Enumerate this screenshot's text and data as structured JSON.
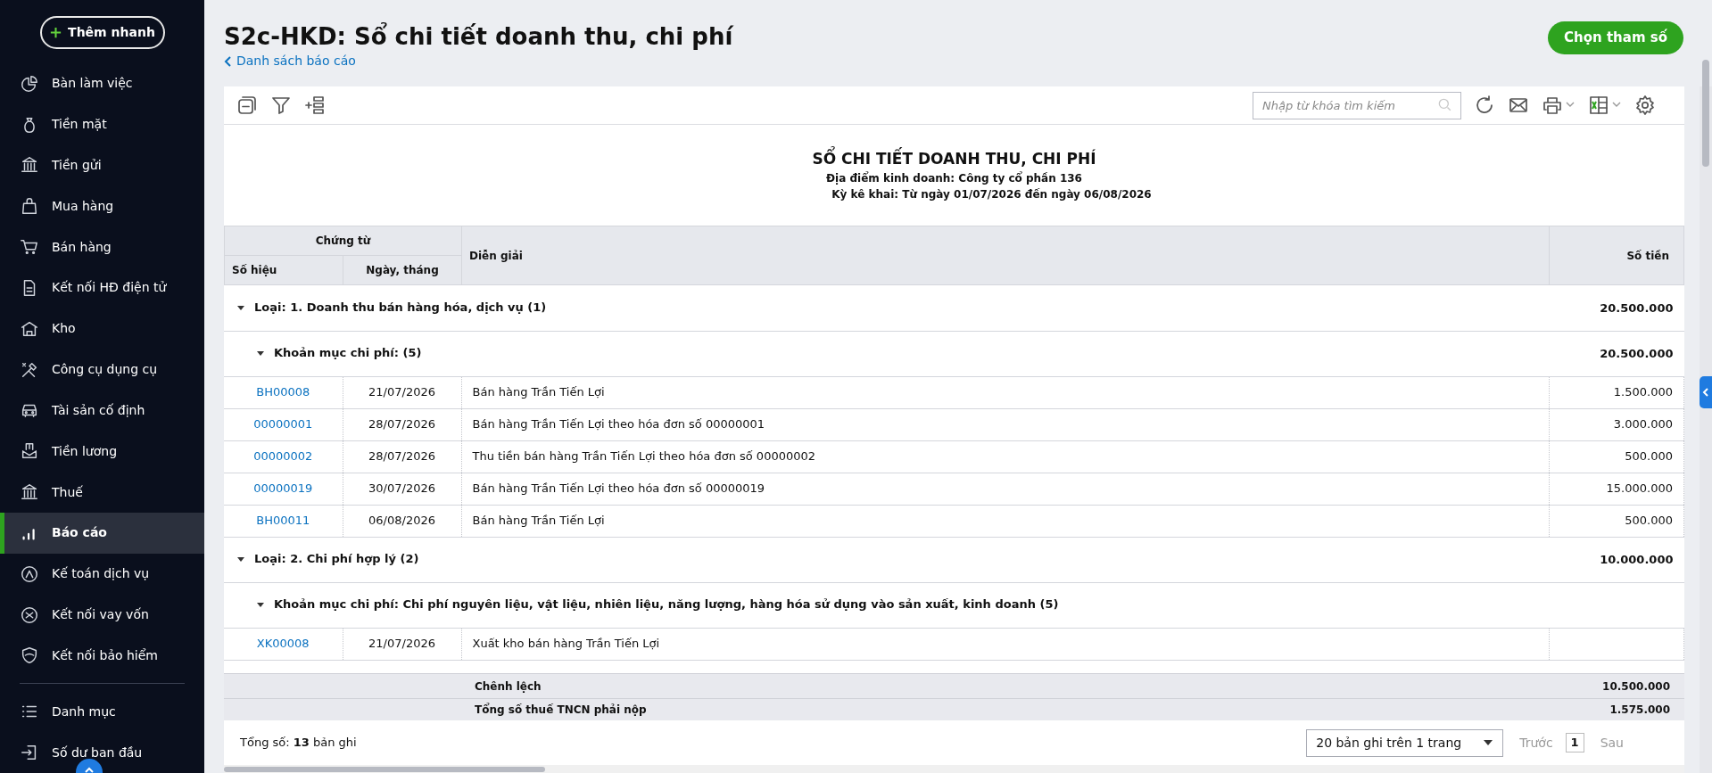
{
  "sidebar": {
    "quick_add": "Thêm nhanh",
    "items": [
      {
        "label": "Bàn làm việc",
        "selected": false
      },
      {
        "label": "Tiền mặt",
        "selected": false
      },
      {
        "label": "Tiền gửi",
        "selected": false
      },
      {
        "label": "Mua hàng",
        "selected": false
      },
      {
        "label": "Bán hàng",
        "selected": false
      },
      {
        "label": "Kết nối HĐ điện tử",
        "selected": false
      },
      {
        "label": "Kho",
        "selected": false
      },
      {
        "label": "Công cụ dụng cụ",
        "selected": false
      },
      {
        "label": "Tài sản cố định",
        "selected": false
      },
      {
        "label": "Tiền lương",
        "selected": false
      },
      {
        "label": "Thuế",
        "selected": false
      },
      {
        "label": "Báo cáo",
        "selected": true
      },
      {
        "label": "Kế toán dịch vụ",
        "selected": false
      },
      {
        "label": "Kết nối vay vốn",
        "selected": false
      },
      {
        "label": "Kết nối bảo hiểm",
        "selected": false
      }
    ],
    "footer_items": [
      {
        "label": "Danh mục",
        "selected": false
      },
      {
        "label": "Số dư ban đầu",
        "selected": false
      }
    ]
  },
  "page": {
    "title": "S2c-HKD: Sổ chi tiết doanh thu, chi phí",
    "back_link": "Danh sách báo cáo",
    "primary_button": "Chọn tham số"
  },
  "toolbar": {
    "search": {
      "placeholder": "Nhập từ khóa tìm kiếm"
    }
  },
  "report": {
    "title": "SỔ CHI TIẾT DOANH THU, CHI PHÍ",
    "lines": [
      "Địa điểm kinh doanh: Công ty cổ phần 136",
      "Kỳ kê khai: Từ ngày 01/07/2026 đến ngày 06/08/2026"
    ]
  },
  "table": {
    "header_group": "Chứng từ",
    "columns": [
      "Số hiệu",
      "Ngày, tháng",
      "Diễn giải",
      "Số tiền"
    ],
    "groups": [
      {
        "label": "Loại: 1. Doanh thu bán hàng hóa, dịch vụ (1)",
        "amount": "20.500.000",
        "expanded": true,
        "children": [
          {
            "label": "Khoản mục chi phí:  (5)",
            "amount": "20.500.000",
            "expanded": true,
            "rows": [
              {
                "number": "BH00008",
                "date": "21/07/2026",
                "description": "Bán hàng Trần Tiến Lợi",
                "amount": "1.500.000"
              },
              {
                "number": "00000001",
                "date": "28/07/2026",
                "description": "Bán hàng Trần Tiến Lợi theo hóa đơn số 00000001",
                "amount": "3.000.000"
              },
              {
                "number": "00000002",
                "date": "28/07/2026",
                "description": "Thu tiền bán hàng Trần Tiến Lợi theo hóa đơn số 00000002",
                "amount": "500.000"
              },
              {
                "number": "00000019",
                "date": "30/07/2026",
                "description": "Bán hàng Trần Tiến Lợi theo hóa đơn số 00000019",
                "amount": "15.000.000"
              },
              {
                "number": "BH00011",
                "date": "06/08/2026",
                "description": "Bán hàng Trần Tiến Lợi",
                "amount": "500.000"
              }
            ]
          }
        ]
      },
      {
        "label": "Loại: 2. Chi phí hợp lý (2)",
        "amount": "10.000.000",
        "expanded": true,
        "children": [
          {
            "label": "Khoản mục chi phí: Chi phí nguyên liệu, vật liệu, nhiên liệu, năng lượng, hàng hóa sử dụng vào sản xuất, kinh doanh (5)",
            "expanded": true,
            "rows": [
              {
                "number": "XK00008",
                "date": "21/07/2026",
                "description": "Xuất kho bán hàng Trần Tiến Lợi"
              }
            ]
          }
        ]
      }
    ],
    "summary": [
      {
        "label": "Chênh lệch",
        "amount": "10.500.000"
      },
      {
        "label": "Tổng số thuế TNCN phải nộp",
        "amount": "1.575.000"
      }
    ]
  },
  "pagination": {
    "total": "Tổng số: **13** bản ghi",
    "page_size": "20 bản ghi trên 1 trang",
    "prev": {
      "label": "Trước",
      "disabled": true
    },
    "pages": [
      {
        "label": "1",
        "selected": true
      }
    ],
    "next": {
      "label": "Sau",
      "disabled": true
    }
  }
}
